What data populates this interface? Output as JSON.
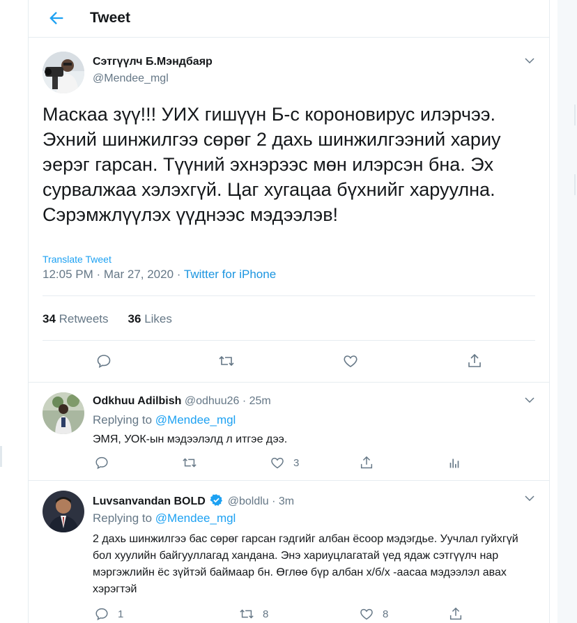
{
  "header": {
    "title": "Tweet",
    "back_icon": "arrow-left-icon"
  },
  "main_tweet": {
    "author_name": "Сэтгүүлч Б.Мэндбаяр",
    "author_handle": "@Mendee_mgl",
    "text": "Маскаа зүү!!! УИХ гишүүн Б-с короновирус илэрчээ. Эхний шинжилгээ сөрөг 2 дахь шинжилгээний хариу эерэг гарсан. Түүний эхнэрээс мөн илэрсэн бна. Эх сурвалжаа хэлэхгүй. Цаг хугацаа бүхнийг харуулна. Сэрэмжлүүлэх үүднээс мэдээлэв!",
    "translate_label": "Translate Tweet",
    "time": "12:05 PM",
    "separator": " · ",
    "date": "Mar 27, 2020",
    "source": "Twitter for iPhone",
    "retweets_count": "34",
    "retweets_label": "Retweets",
    "likes_count": "36",
    "likes_label": "Likes"
  },
  "replies": [
    {
      "author_name": "Odkhuu Adilbish",
      "author_handle": "@odhuu26",
      "time": "· 25m",
      "replying_label": "Replying to",
      "replying_to": "@Mendee_mgl",
      "text": "ЭМЯ, УОК-ын мэдээлэлд л итгэе дээ.",
      "reply_count": "",
      "retweet_count": "",
      "like_count": "3"
    },
    {
      "author_name": "Luvsanvandan BOLD",
      "author_handle": "@boldlu",
      "time": "· 3m",
      "replying_label": "Replying to",
      "replying_to": "@Mendee_mgl",
      "text": "2 дахь шинжилгээ бас сөрөг гарсан гэдгийг албан ёсоор мэдэгдье. Уучлал гуйхгүй бол хуулийн байгууллагад хандана. Энэ хариуцлагатай үед ядаж сэтгүүлч нар мэргэжлийн ёс зүйтэй баймаар бн. Өглөө бүр албан х/б/х -аасаа мэдээлэл авах хэрэгтэй",
      "reply_count": "1",
      "retweet_count": "8",
      "like_count": "8"
    }
  ],
  "colors": {
    "accent": "#1da1f2",
    "text": "#14171a",
    "muted": "#657786",
    "border": "#e6ecf0",
    "verified": "#1da1f2"
  }
}
